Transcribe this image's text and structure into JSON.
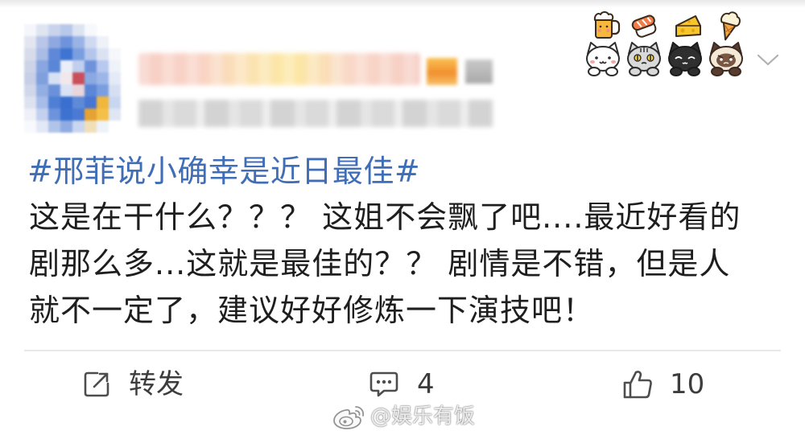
{
  "post": {
    "hashtag": "#邢菲说小确幸是近日最佳#",
    "body_lines": [
      "这是在干什么？？？ 这姐不会飘了吧....最近好看的",
      "剧那么多...这就是最佳的？？ 剧情是不错，但是人",
      "就不一定了，建议好好修炼一下演技吧！"
    ]
  },
  "actions": {
    "repost_label": "转发",
    "comment_count": "4",
    "like_count": "10"
  },
  "watermark": {
    "text": "@娱乐有饭"
  },
  "icons": {
    "share": "share-icon",
    "comment": "comment-icon",
    "like": "thumbs-up-icon",
    "more": "chevron-down-icon",
    "watermark_logo": "weibo-logo-icon"
  },
  "card_decoration": [
    "beer-icon",
    "sushi-icon",
    "cheese-icon",
    "ice-cream-icon",
    "white-cat-icon",
    "gray-cat-icon",
    "black-cat-icon",
    "siamese-cat-icon"
  ],
  "colors": {
    "hashtag": "#3f6db6",
    "body_text": "#1e1e1e",
    "action_text": "#3c3c3c",
    "icon": "#4d4d4d",
    "divider": "#e8e8e8"
  }
}
